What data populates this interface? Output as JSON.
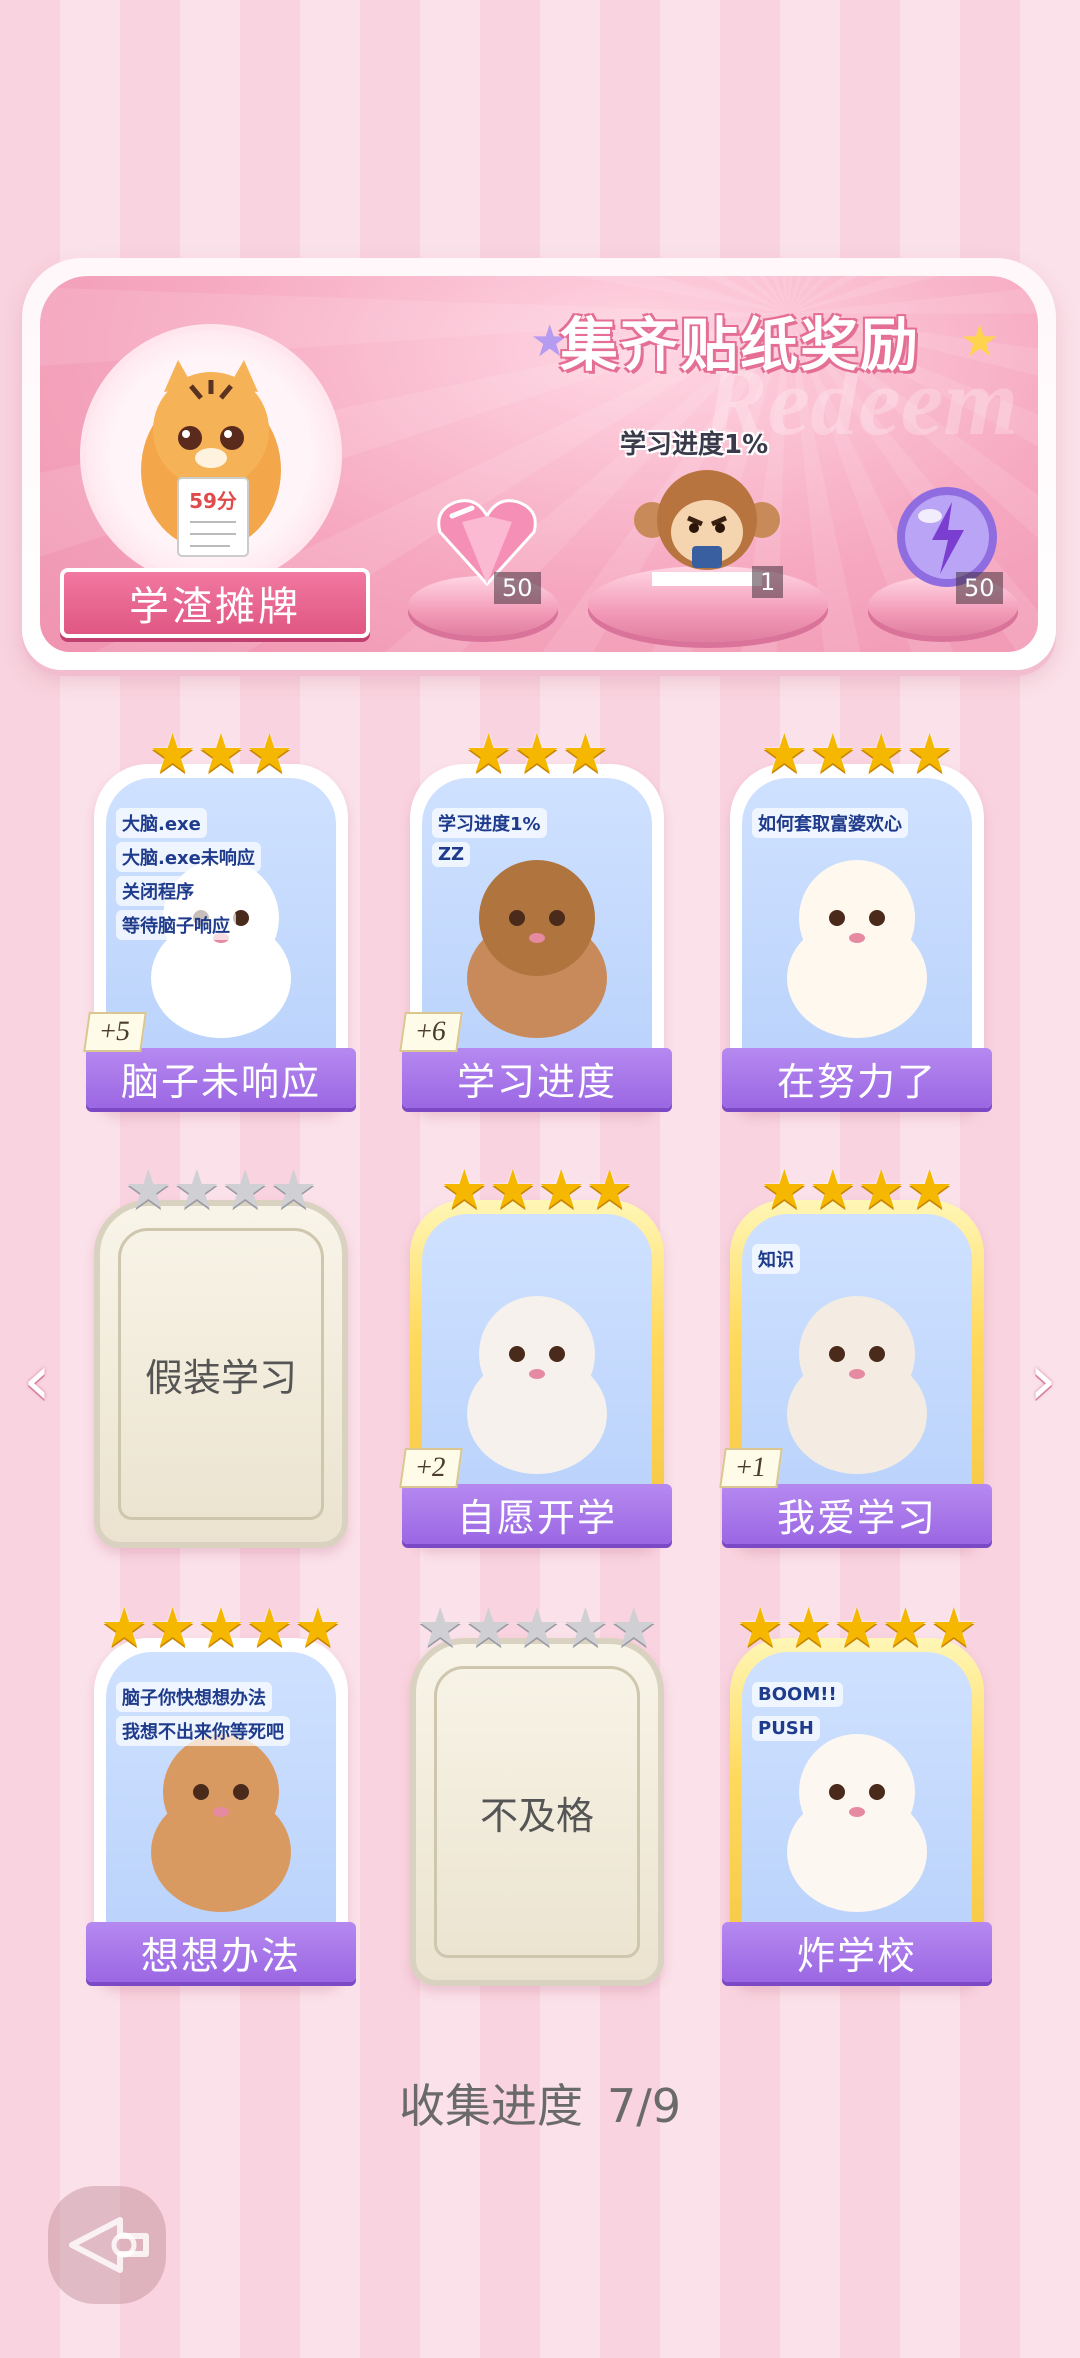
{
  "banner": {
    "title": "集齐贴纸奖励",
    "watermark": "Redeem",
    "avatar_title": "学渣摊牌",
    "avatar_sticker_text": "59分",
    "reward_caption": "学习进度1%",
    "rewards": [
      {
        "icon": "heart-gem-icon",
        "count": "50"
      },
      {
        "icon": "monkey-sticker-icon",
        "count": "1"
      },
      {
        "icon": "lightning-orb-icon",
        "count": "50"
      }
    ]
  },
  "cards": [
    {
      "name": "脑子未响应",
      "stars": 3,
      "stars_filled": 3,
      "collected": true,
      "plus": "+5",
      "art_text": [
        "大脑.exe",
        "大脑.exe未响应",
        "关闭程序",
        "等待脑子响应"
      ],
      "frame": "white"
    },
    {
      "name": "学习进度",
      "stars": 3,
      "stars_filled": 3,
      "collected": true,
      "plus": "+6",
      "art_text": [
        "学习进度1%",
        "ZZ"
      ],
      "frame": "white"
    },
    {
      "name": "在努力了",
      "stars": 4,
      "stars_filled": 4,
      "collected": true,
      "plus": "",
      "art_text": [
        "如何套取富婆欢心"
      ],
      "frame": "white"
    },
    {
      "name": "假装学习",
      "stars": 4,
      "stars_filled": 0,
      "collected": false,
      "plus": "",
      "art_text": [],
      "frame": "locked"
    },
    {
      "name": "自愿开学",
      "stars": 4,
      "stars_filled": 4,
      "collected": true,
      "plus": "+2",
      "art_text": [],
      "frame": "gold"
    },
    {
      "name": "我爱学习",
      "stars": 4,
      "stars_filled": 4,
      "collected": true,
      "plus": "+1",
      "art_text": [
        "知识"
      ],
      "frame": "gold"
    },
    {
      "name": "想想办法",
      "stars": 5,
      "stars_filled": 5,
      "collected": true,
      "plus": "",
      "art_text": [
        "脑子你快想想办法",
        "我想不出来你等死吧"
      ],
      "frame": "white"
    },
    {
      "name": "不及格",
      "stars": 5,
      "stars_filled": 0,
      "collected": false,
      "plus": "",
      "art_text": [],
      "frame": "locked"
    },
    {
      "name": "炸学校",
      "stars": 5,
      "stars_filled": 5,
      "collected": true,
      "plus": "",
      "art_text": [
        "BOOM!!",
        "PUSH"
      ],
      "frame": "gold"
    }
  ],
  "progress": {
    "label": "收集进度",
    "value": "7/9"
  },
  "nav": {
    "prev_icon": "chevron-left-icon",
    "next_icon": "chevron-right-icon",
    "back_icon": "back-arrow-icon"
  },
  "colors": {
    "label_purple": "#9b67e3",
    "banner_pink": "#f6a8c0",
    "star_gold": "#f5b700",
    "star_grey": "#cfcfd4"
  }
}
